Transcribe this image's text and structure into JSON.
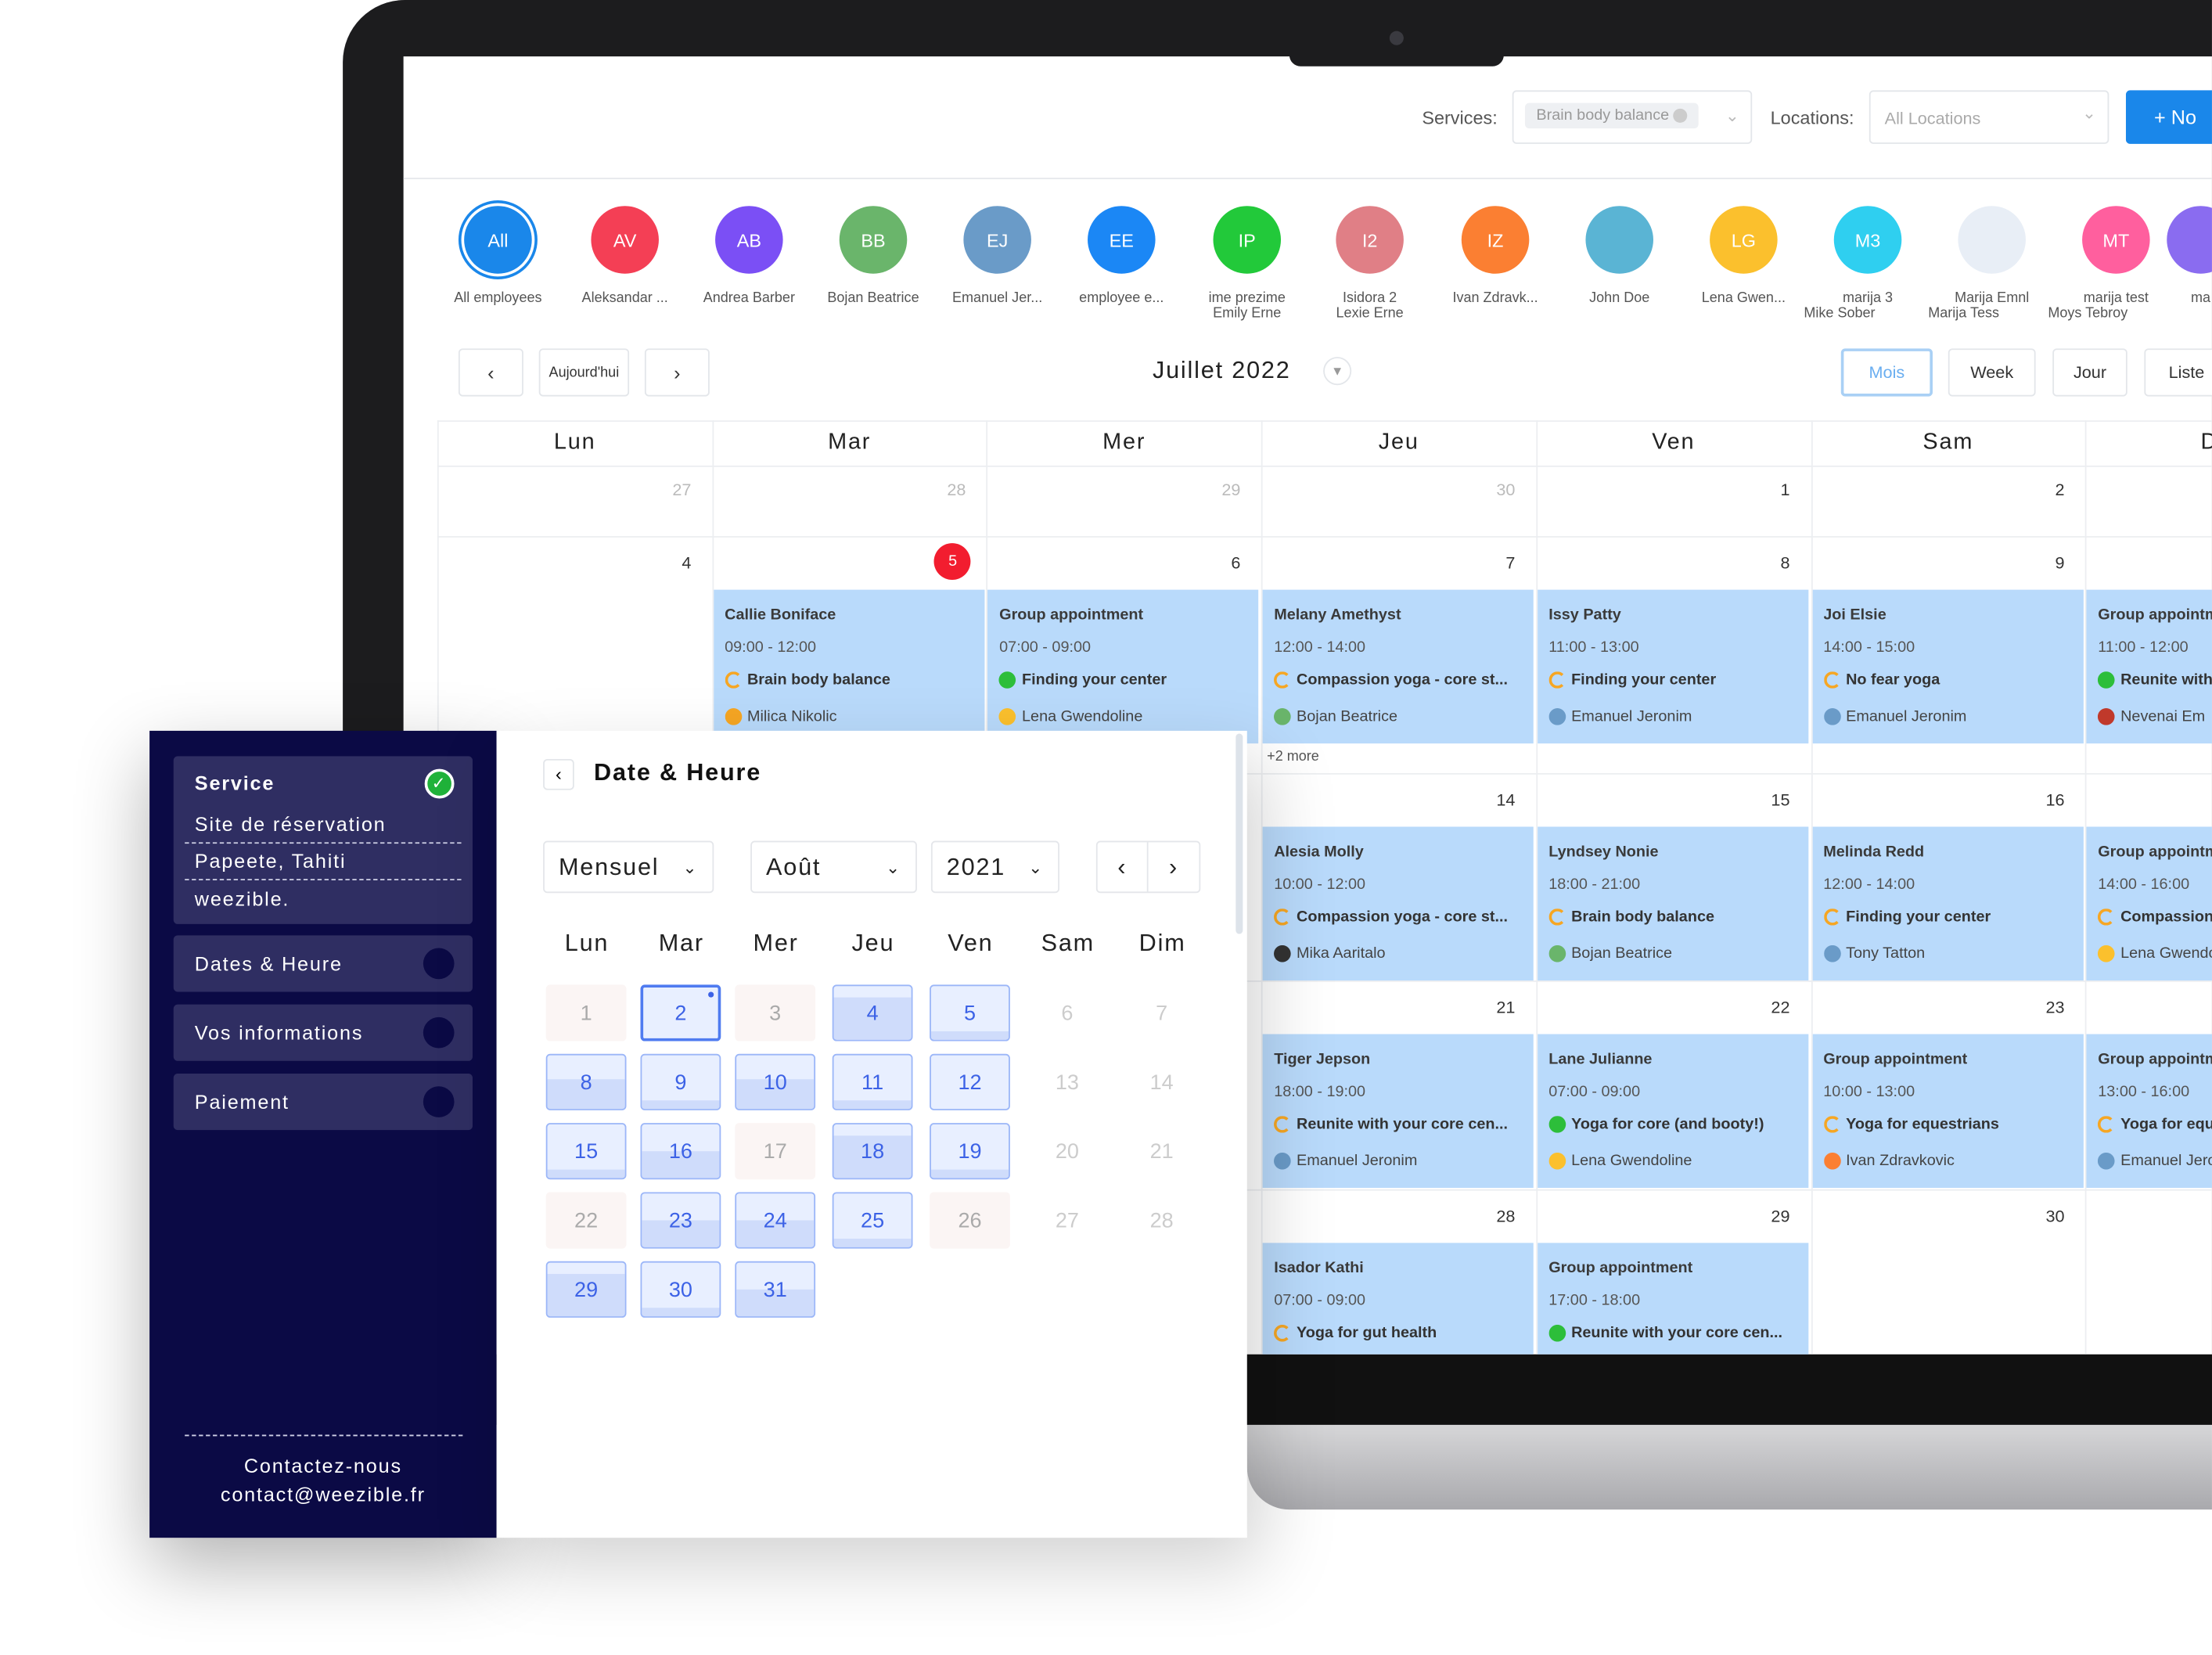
{
  "topbar": {
    "services_label": "Services:",
    "services_value": "Brain body balance",
    "locations_label": "Locations:",
    "locations_placeholder": "All Locations",
    "new_button": "+ No"
  },
  "employees": [
    {
      "initials": "All",
      "name": "All employees",
      "color": "#1a87ea",
      "selected": true
    },
    {
      "initials": "AV",
      "name": "Aleksandar ...",
      "color": "#f43f55"
    },
    {
      "initials": "AB",
      "name": "Andrea Barber",
      "color": "#7b4ff5"
    },
    {
      "initials": "BB",
      "name": "Bojan Beatrice",
      "color": "#6ab56b"
    },
    {
      "initials": "EJ",
      "name": "Emanuel Jer...",
      "color": "#6a9bc8"
    },
    {
      "initials": "EE",
      "name": "employee e...",
      "color": "#1b87f5"
    },
    {
      "initials": "IP",
      "name": "ime prezime",
      "sub": "Emily Erne",
      "color": "#22c93a"
    },
    {
      "initials": "I2",
      "name": "Isidora 2",
      "sub": "Lexie Erne",
      "color": "#e07f86"
    },
    {
      "initials": "IZ",
      "name": "Ivan Zdravk...",
      "color": "#fb7f32"
    },
    {
      "initials": "",
      "name": "John Doe",
      "color": "#5ab4d4",
      "photo": true
    },
    {
      "initials": "LG",
      "name": "Lena Gwen...",
      "color": "#fbc02d"
    },
    {
      "initials": "M3",
      "name": "marija 3",
      "sub": "Mike Sober",
      "color": "#2fcff0"
    },
    {
      "initials": "",
      "name": "Marija Emnl",
      "sub": "Marija Tess",
      "color": "#e8eef6",
      "photo": true
    },
    {
      "initials": "MT",
      "name": "marija test",
      "sub": "Moys Tebroy",
      "color": "#ff5f9e"
    },
    {
      "initials": "",
      "name": "ma",
      "color": "#8a6cf0"
    }
  ],
  "nav": {
    "prev": "‹",
    "today": "Aujourd'hui",
    "next": "›",
    "title": "Juillet 2022",
    "views": [
      "Mois",
      "Week",
      "Jour",
      "Liste"
    ],
    "active_view": "Mois"
  },
  "calendar": {
    "weekdays": [
      "Lun",
      "Mar",
      "Mer",
      "Jeu",
      "Ven",
      "Sam",
      "Dim"
    ],
    "weeks": [
      {
        "dates": [
          {
            "col": 0,
            "d": "27",
            "muted": true
          },
          {
            "col": 1,
            "d": "28",
            "muted": true
          },
          {
            "col": 2,
            "d": "29",
            "muted": true
          },
          {
            "col": 3,
            "d": "30",
            "muted": true
          },
          {
            "col": 4,
            "d": "1"
          },
          {
            "col": 5,
            "d": "2"
          }
        ],
        "events": []
      },
      {
        "dates": [
          {
            "col": 0,
            "d": "4"
          },
          {
            "col": 1,
            "d": "5",
            "today": true
          },
          {
            "col": 2,
            "d": "6"
          },
          {
            "col": 3,
            "d": "7"
          },
          {
            "col": 4,
            "d": "8"
          },
          {
            "col": 5,
            "d": "9"
          }
        ],
        "events": [
          {
            "col": 1,
            "title": "Callie Boniface",
            "time": "09:00 - 12:00",
            "status": "pending",
            "service": "Brain body balance",
            "employee": "Milica Nikolic",
            "emp_color": "#f6a623"
          },
          {
            "col": 2,
            "title": "Group appointment",
            "time": "07:00 - 09:00",
            "status": "ok",
            "service": "Finding your center",
            "employee": "Lena Gwendoline",
            "emp_color": "#fbc02d"
          },
          {
            "col": 3,
            "title": "Melany Amethyst",
            "time": "12:00 - 14:00",
            "status": "pending",
            "service": "Compassion yoga - core st...",
            "employee": "Bojan Beatrice",
            "emp_color": "#6ab56b",
            "more": "+2 more"
          },
          {
            "col": 4,
            "title": "Issy Patty",
            "time": "11:00 - 13:00",
            "status": "pending",
            "service": "Finding your center",
            "employee": "Emanuel Jeronim",
            "emp_color": "#6a9bc8"
          },
          {
            "col": 5,
            "title": "Joi Elsie",
            "time": "14:00 - 15:00",
            "status": "pending",
            "service": "No fear yoga",
            "employee": "Emanuel Jeronim",
            "emp_color": "#6a9bc8"
          },
          {
            "col": 6,
            "title": "Group appointment",
            "time": "11:00 - 12:00",
            "status": "ok",
            "service": "Reunite with your core",
            "employee": "Nevenai Em",
            "emp_color": "#c0392b"
          }
        ]
      },
      {
        "dates": [
          {
            "col": 3,
            "d": "14"
          },
          {
            "col": 4,
            "d": "15"
          },
          {
            "col": 5,
            "d": "16"
          }
        ],
        "events": [
          {
            "col": 3,
            "title": "Alesia Molly",
            "time": "10:00 - 12:00",
            "status": "pending",
            "service": "Compassion yoga - core st...",
            "employee": "Mika Aaritalo",
            "emp_color": "#333"
          },
          {
            "col": 4,
            "title": "Lyndsey Nonie",
            "time": "18:00 - 21:00",
            "status": "pending",
            "service": "Brain body balance",
            "employee": "Bojan Beatrice",
            "emp_color": "#6ab56b"
          },
          {
            "col": 5,
            "title": "Melinda Redd",
            "time": "12:00 - 14:00",
            "status": "pending",
            "service": "Finding your center",
            "employee": "Tony Tatton",
            "emp_color": "#6a9bc8"
          },
          {
            "col": 6,
            "title": "Group appointment",
            "time": "14:00 - 16:00",
            "status": "pending",
            "service": "Compassion yoga",
            "employee": "Lena Gwendoline",
            "emp_color": "#fbc02d"
          }
        ]
      },
      {
        "dates": [
          {
            "col": 3,
            "d": "21"
          },
          {
            "col": 4,
            "d": "22"
          },
          {
            "col": 5,
            "d": "23"
          }
        ],
        "events": [
          {
            "col": 3,
            "title": "Tiger Jepson",
            "time": "18:00 - 19:00",
            "status": "pending",
            "service": "Reunite with your core cen...",
            "employee": "Emanuel Jeronim",
            "emp_color": "#6a9bc8"
          },
          {
            "col": 4,
            "title": "Lane Julianne",
            "time": "07:00 - 09:00",
            "status": "ok",
            "service": "Yoga for core (and booty!)",
            "employee": "Lena Gwendoline",
            "emp_color": "#fbc02d"
          },
          {
            "col": 5,
            "title": "Group appointment",
            "time": "10:00 - 13:00",
            "status": "pending",
            "service": "Yoga for equestrians",
            "employee": "Ivan Zdravkovic",
            "emp_color": "#fb7f32"
          },
          {
            "col": 6,
            "title": "Group appointment",
            "time": "13:00 - 16:00",
            "status": "pending",
            "service": "Yoga for equestrians",
            "employee": "Emanuel Jeronim",
            "emp_color": "#6a9bc8"
          }
        ]
      },
      {
        "dates": [
          {
            "col": 3,
            "d": "28"
          },
          {
            "col": 4,
            "d": "29"
          },
          {
            "col": 5,
            "d": "30"
          }
        ],
        "events": [
          {
            "col": 3,
            "title": "Isador Kathi",
            "time": "07:00 - 09:00",
            "status": "pending",
            "service": "Yoga for gut health"
          },
          {
            "col": 4,
            "title": "Group appointment",
            "time": "17:00 - 18:00",
            "status": "ok",
            "service": "Reunite with your core cen..."
          }
        ]
      }
    ]
  },
  "sidebar": {
    "service_title": "Service",
    "service_lines": [
      "Site de réservation",
      "Papeete, Tahiti",
      "weezible."
    ],
    "steps": [
      "Dates & Heure",
      "Vos informations",
      "Paiement"
    ],
    "contact_label": "Contactez-nous",
    "contact_email": "contact@weezible.fr"
  },
  "picker": {
    "title": "Date & Heure",
    "mode": "Mensuel",
    "month": "Août",
    "year": "2021",
    "weekdays": [
      "Lun",
      "Mar",
      "Mer",
      "Jeu",
      "Ven",
      "Sam",
      "Dim"
    ],
    "days": [
      {
        "d": "1",
        "state": "off"
      },
      {
        "d": "2",
        "state": "selected",
        "availability": 0
      },
      {
        "d": "3",
        "state": "off"
      },
      {
        "d": "4",
        "state": "available",
        "availability": 0.8
      },
      {
        "d": "5",
        "state": "available",
        "availability": 0.15
      },
      {
        "d": "6",
        "state": "weekend"
      },
      {
        "d": "7",
        "state": "weekend"
      },
      {
        "d": "8",
        "state": "available",
        "availability": 0.55
      },
      {
        "d": "9",
        "state": "available",
        "availability": 0.15
      },
      {
        "d": "10",
        "state": "available",
        "availability": 0.55
      },
      {
        "d": "11",
        "state": "available",
        "availability": 0.15
      },
      {
        "d": "12",
        "state": "available",
        "availability": 0
      },
      {
        "d": "13",
        "state": "weekend"
      },
      {
        "d": "14",
        "state": "weekend"
      },
      {
        "d": "15",
        "state": "available",
        "availability": 0.15
      },
      {
        "d": "16",
        "state": "available",
        "availability": 0.5
      },
      {
        "d": "17",
        "state": "off"
      },
      {
        "d": "18",
        "state": "available",
        "availability": 0.8
      },
      {
        "d": "19",
        "state": "available",
        "availability": 0.15
      },
      {
        "d": "20",
        "state": "weekend"
      },
      {
        "d": "21",
        "state": "weekend"
      },
      {
        "d": "22",
        "state": "off"
      },
      {
        "d": "23",
        "state": "available",
        "availability": 0.5
      },
      {
        "d": "24",
        "state": "available",
        "availability": 0.5
      },
      {
        "d": "25",
        "state": "available",
        "availability": 0.15
      },
      {
        "d": "26",
        "state": "off"
      },
      {
        "d": "27",
        "state": "weekend"
      },
      {
        "d": "28",
        "state": "weekend"
      },
      {
        "d": "29",
        "state": "available",
        "availability": 0.8
      },
      {
        "d": "30",
        "state": "available",
        "availability": 0.15
      },
      {
        "d": "31",
        "state": "available",
        "availability": 0.5
      }
    ]
  }
}
